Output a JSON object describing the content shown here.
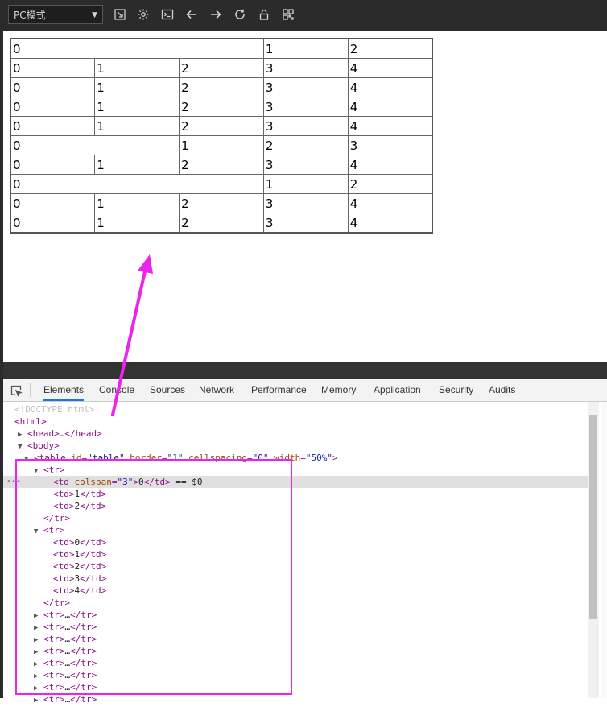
{
  "toolbar": {
    "mode_label": "PC模式",
    "icons": [
      "screen-capture-icon",
      "gear-icon",
      "console-icon",
      "back-arrow-icon",
      "forward-arrow-icon",
      "reload-icon",
      "lock-icon",
      "qr-code-icon"
    ]
  },
  "table": {
    "rows": [
      [
        {
          "t": "0",
          "c": 3
        },
        {
          "t": "1",
          "c": 1
        },
        {
          "t": "2",
          "c": 1
        }
      ],
      [
        {
          "t": "0",
          "c": 1
        },
        {
          "t": "1",
          "c": 1
        },
        {
          "t": "2",
          "c": 1
        },
        {
          "t": "3",
          "c": 1
        },
        {
          "t": "4",
          "c": 1
        }
      ],
      [
        {
          "t": "0",
          "c": 1
        },
        {
          "t": "1",
          "c": 1
        },
        {
          "t": "2",
          "c": 1
        },
        {
          "t": "3",
          "c": 1
        },
        {
          "t": "4",
          "c": 1
        }
      ],
      [
        {
          "t": "0",
          "c": 1
        },
        {
          "t": "1",
          "c": 1
        },
        {
          "t": "2",
          "c": 1
        },
        {
          "t": "3",
          "c": 1
        },
        {
          "t": "4",
          "c": 1
        }
      ],
      [
        {
          "t": "0",
          "c": 1
        },
        {
          "t": "1",
          "c": 1
        },
        {
          "t": "2",
          "c": 1
        },
        {
          "t": "3",
          "c": 1
        },
        {
          "t": "4",
          "c": 1
        }
      ],
      [
        {
          "t": "0",
          "c": 2
        },
        {
          "t": "1",
          "c": 1
        },
        {
          "t": "2",
          "c": 1
        },
        {
          "t": "3",
          "c": 1
        }
      ],
      [
        {
          "t": "0",
          "c": 1
        },
        {
          "t": "1",
          "c": 1
        },
        {
          "t": "2",
          "c": 1
        },
        {
          "t": "3",
          "c": 1
        },
        {
          "t": "4",
          "c": 1
        }
      ],
      [
        {
          "t": "0",
          "c": 3
        },
        {
          "t": "1",
          "c": 1
        },
        {
          "t": "2",
          "c": 1
        }
      ],
      [
        {
          "t": "0",
          "c": 1
        },
        {
          "t": "1",
          "c": 1
        },
        {
          "t": "2",
          "c": 1
        },
        {
          "t": "3",
          "c": 1
        },
        {
          "t": "4",
          "c": 1
        }
      ],
      [
        {
          "t": "0",
          "c": 1
        },
        {
          "t": "1",
          "c": 1
        },
        {
          "t": "2",
          "c": 1
        },
        {
          "t": "3",
          "c": 1
        },
        {
          "t": "4",
          "c": 1
        }
      ]
    ]
  },
  "devtools": {
    "tabs": [
      "Elements",
      "Console",
      "Sources",
      "Network",
      "Performance",
      "Memory",
      "Application",
      "Security",
      "Audits"
    ],
    "active_tab": "Elements",
    "dom_lines": [
      "<!DOCTYPE html>",
      "<html>",
      "<head>…</head>",
      "<body>",
      "<table id=\"table\" border=\"1\" cellspacing=\"0\" width=\"50%\">",
      "<tr>",
      "<td colspan=\"3\">0</td> == $0",
      "<td>1</td>",
      "<td>2</td>",
      "</tr>",
      "<tr>",
      "<td>0</td>",
      "<td>1</td>",
      "<td>2</td>",
      "<td>3</td>",
      "<td>4</td>",
      "</tr>",
      "<tr>…</tr>",
      "<tr>…</tr>",
      "<tr>…</tr>",
      "<tr>…</tr>",
      "<tr>…</tr>",
      "<tr>…</tr>",
      "<tr>…</tr>",
      "<tr>…</tr>"
    ],
    "selected_line": 6
  },
  "colors": {
    "annotation": "#ee22ee",
    "toolbar_bg": "#2b2b2b",
    "active_tab_underline": "#1a73e8"
  }
}
